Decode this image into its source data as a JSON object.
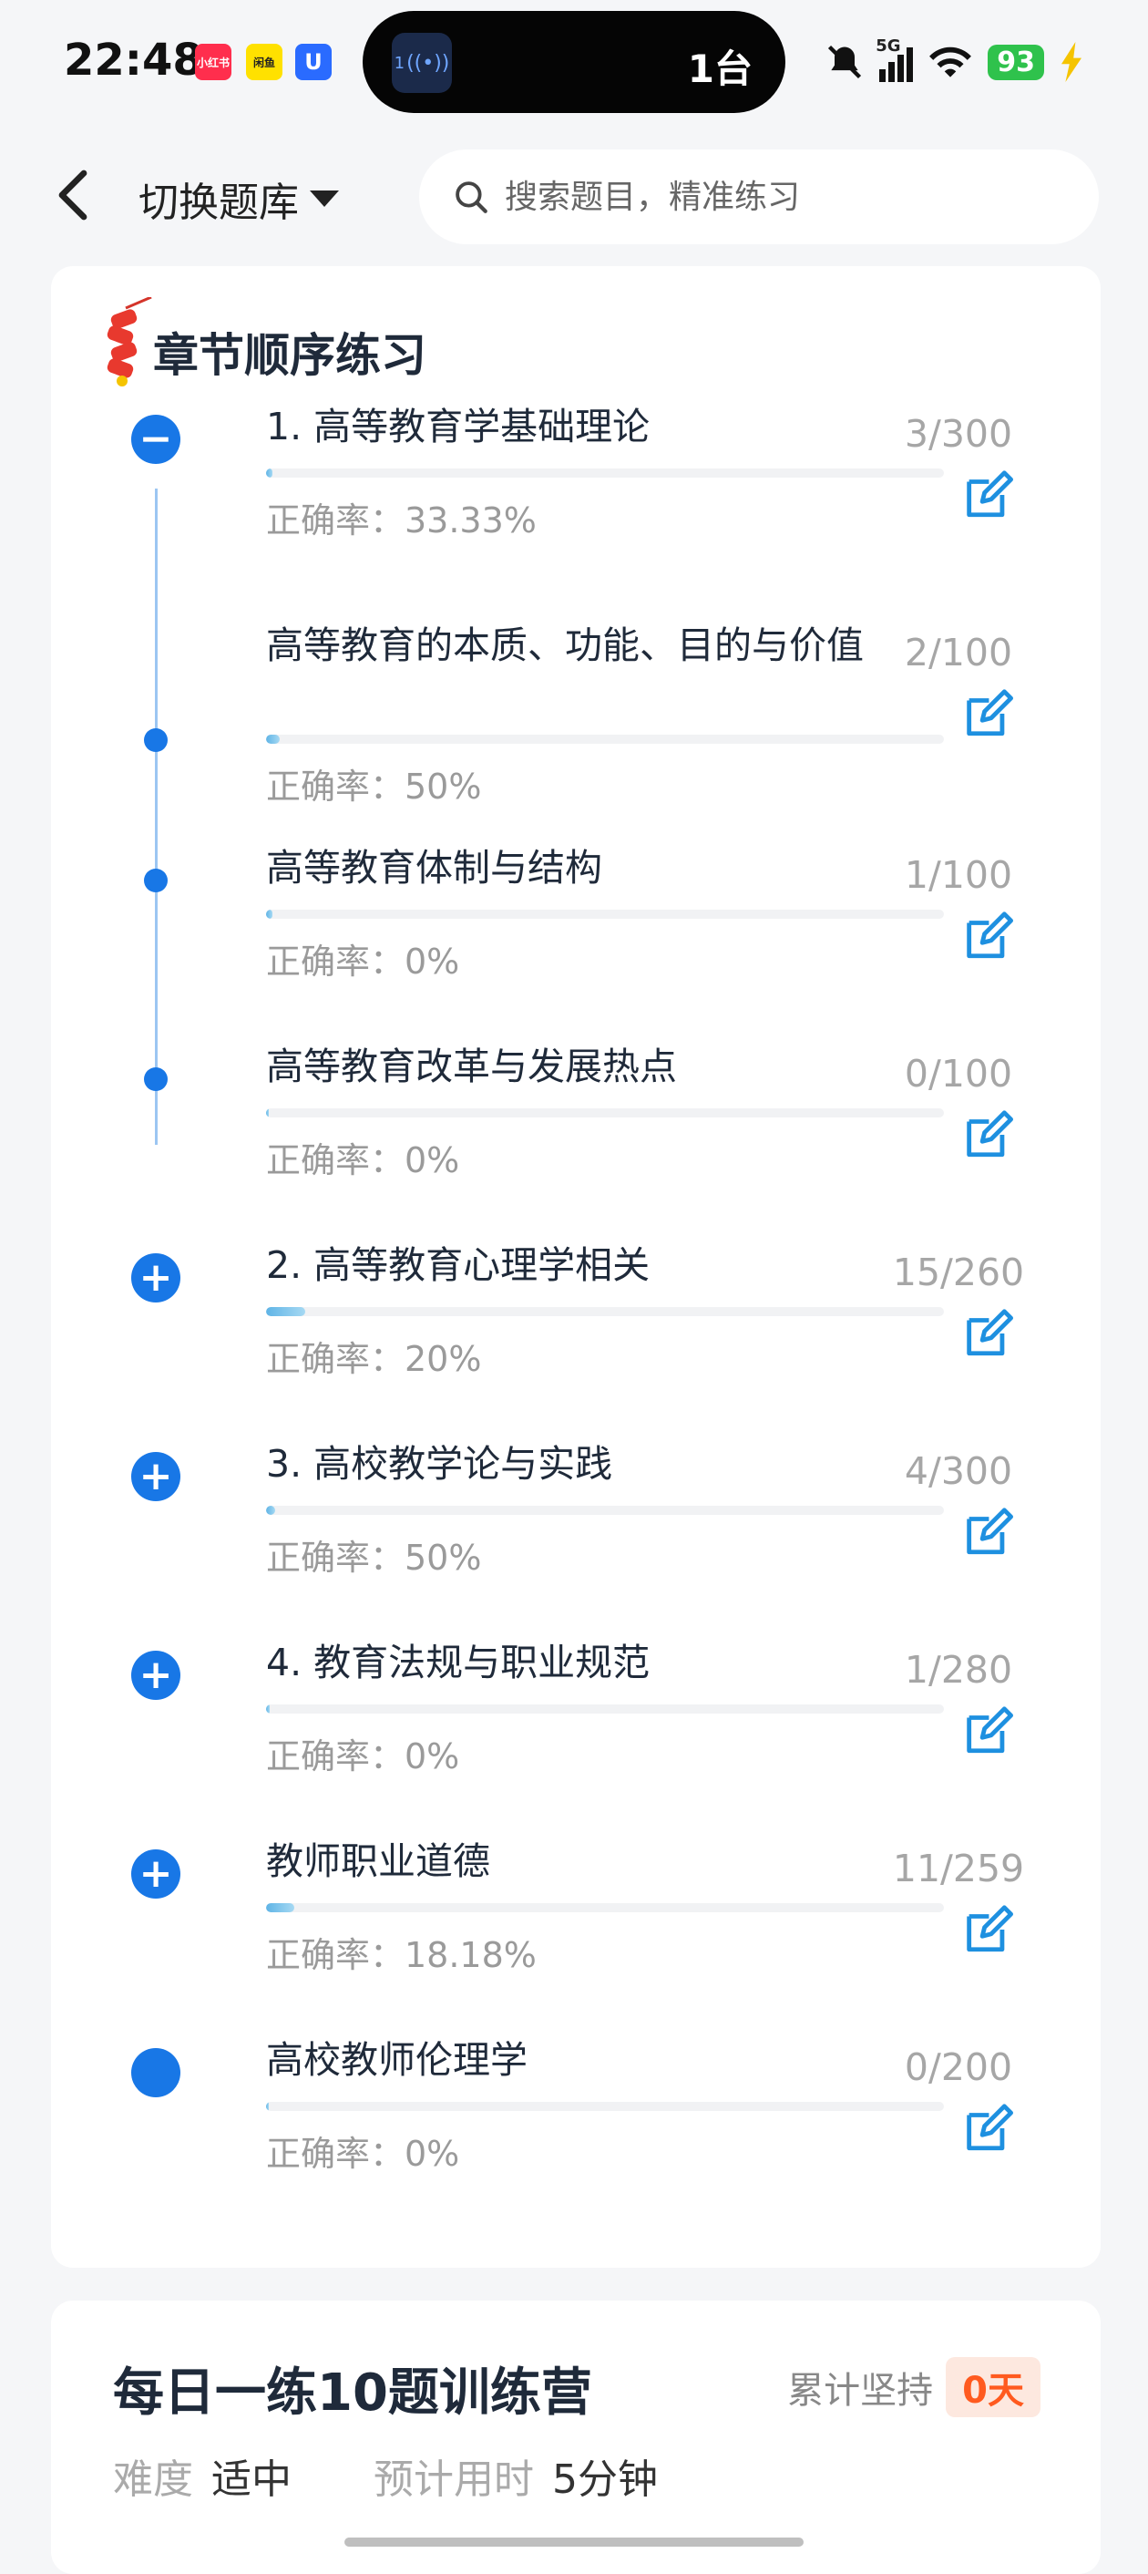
{
  "status_bar": {
    "time": "22:48",
    "apps": [
      "小红书",
      "闲鱼",
      "U"
    ],
    "island_label": "1台",
    "island_icon_number": "1",
    "network": "5G",
    "battery": "93"
  },
  "header": {
    "switch_label": "切换题库",
    "search_placeholder": "搜索题目，精准练习"
  },
  "section": {
    "title": "章节顺序练习",
    "items": [
      {
        "title": "1. 高等教育学基础理论",
        "accuracy": "正确率：33.33%",
        "count": "3/300",
        "progress": 0.01,
        "marker": "minus"
      },
      {
        "title": "高等教育的本质、功能、目的与价值",
        "accuracy": "正确率：50%",
        "count": "2/100",
        "progress": 0.02,
        "marker": "dot"
      },
      {
        "title": "高等教育体制与结构",
        "accuracy": "正确率：0%",
        "count": "1/100",
        "progress": 0.01,
        "marker": "dot"
      },
      {
        "title": "高等教育改革与发展热点",
        "accuracy": "正确率：0%",
        "count": "0/100",
        "progress": 0.0,
        "marker": "dot"
      },
      {
        "title": "2. 高等教育心理学相关",
        "accuracy": "正确率：20%",
        "count": "15/260",
        "progress": 0.058,
        "marker": "plus"
      },
      {
        "title": "3. 高校教学论与实践",
        "accuracy": "正确率：50%",
        "count": "4/300",
        "progress": 0.013,
        "marker": "plus"
      },
      {
        "title": "4. 教育法规与职业规范",
        "accuracy": "正确率：0%",
        "count": "1/280",
        "progress": 0.004,
        "marker": "plus"
      },
      {
        "title": "教师职业道德",
        "accuracy": "正确率：18.18%",
        "count": "11/259",
        "progress": 0.042,
        "marker": "plus"
      },
      {
        "title": "高校教师伦理学",
        "accuracy": "正确率：0%",
        "count": "0/200",
        "progress": 0.0,
        "marker": "filled"
      }
    ]
  },
  "daily": {
    "title": "每日一练10题训练营",
    "persist_label": "累计坚持",
    "days": "0天",
    "difficulty_label": "难度",
    "difficulty_value": "适中",
    "time_label": "预计用时",
    "time_value": "5分钟"
  },
  "colors": {
    "accent": "#1877e6",
    "progress": "#5fb4e6",
    "badge_text": "#ff5a1f"
  }
}
